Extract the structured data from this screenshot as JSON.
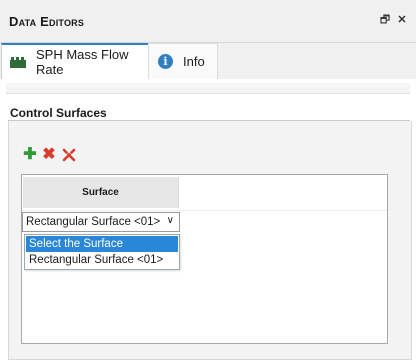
{
  "window": {
    "title": "Data Editors",
    "icons": [
      "restore-icon",
      "close-icon"
    ]
  },
  "tabs": [
    {
      "label": "SPH Mass Flow Rate",
      "icon": "block-icon",
      "active": true
    },
    {
      "label": "Info",
      "icon": "info-icon",
      "active": false
    }
  ],
  "group": {
    "title": "Control Surfaces"
  },
  "toolbar": {
    "add_icon": "plus-icon",
    "remove_icon": "x-icon",
    "remove_all_icon": "double-x-icon",
    "colors": {
      "add": "#2e9a3a",
      "remove": "#d93a2b",
      "remove_all": "#d93a2b"
    }
  },
  "table": {
    "header": "Surface",
    "selected_value": "Rectangular Surface <01>",
    "options": [
      "Select the Surface",
      "Rectangular Surface <01>"
    ]
  },
  "colors": {
    "accent": "#2f7fc1",
    "highlight": "#2a87d8",
    "info_icon": "#2f7fc1",
    "block_icon": "#2e6b3a"
  }
}
